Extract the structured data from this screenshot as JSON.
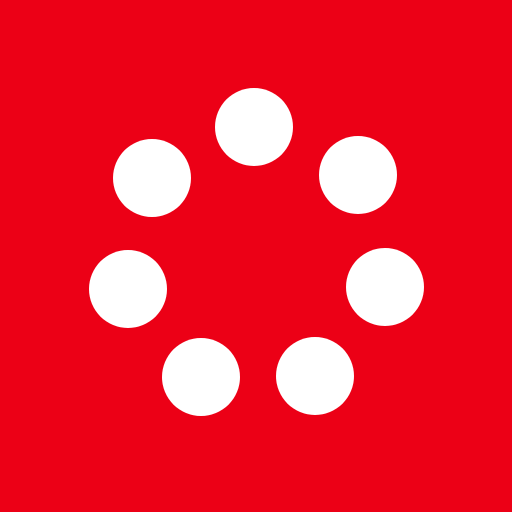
{
  "colors": {
    "background": "#EC0016",
    "dot": "#FFFFFF"
  },
  "icon": {
    "name": "loading-spinner-icon",
    "dot_count": 7
  }
}
